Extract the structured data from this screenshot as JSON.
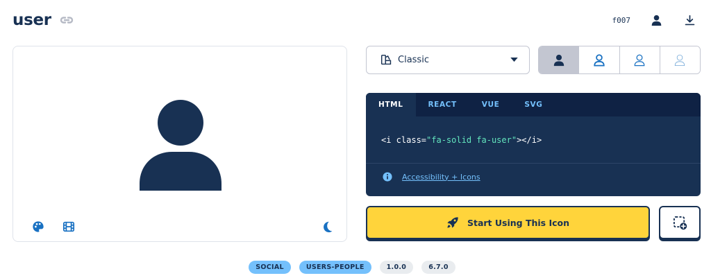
{
  "header": {
    "title": "user",
    "unicode": "f007"
  },
  "style_select": {
    "selected": "Classic"
  },
  "code": {
    "tabs": [
      "HTML",
      "REACT",
      "VUE",
      "SVG"
    ],
    "active_tab": "HTML",
    "snippet_prefix": "<i class=",
    "snippet_class": "\"fa-solid fa-user\"",
    "snippet_suffix": "></i>",
    "a11y_link": "Accessibility + Icons"
  },
  "actions": {
    "start_label": "Start Using This Icon"
  },
  "tags": {
    "categories": [
      "SOCIAL",
      "USERS-PEOPLE"
    ],
    "versions": [
      "1.0.0",
      "6.7.0"
    ]
  },
  "colors": {
    "navy": "#183153",
    "yellow": "#ffd43b",
    "blue": "#74c0fc",
    "teal": "#63e6be",
    "icon_blue": "#1971c2"
  },
  "icons": {
    "title": "link-icon",
    "header_tools": [
      "user-icon",
      "download-icon"
    ],
    "preview_tools": [
      "palette-icon",
      "film-icon",
      "moon-icon"
    ],
    "style_select": [
      "shapes-icon",
      "caret-down-icon"
    ],
    "weights": [
      "user-solid-icon",
      "user-regular-icon",
      "user-light-icon",
      "user-thin-icon"
    ],
    "info": "info-circle-icon",
    "start": "rocket-icon",
    "add_kit": "square-plus-icon"
  }
}
